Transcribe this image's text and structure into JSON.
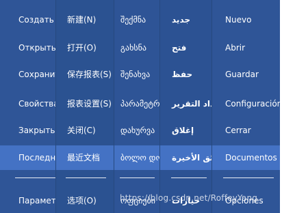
{
  "columns": [
    {
      "lang": "ru",
      "items": [
        "Создать",
        "Открыть",
        "Сохранить",
        "Свойства",
        "Закрыть",
        "Последние",
        "Параметры"
      ]
    },
    {
      "lang": "zh",
      "items": [
        "新建(N)",
        "打开(O)",
        "保存报表(S)",
        "报表设置(S)",
        "关闭(C)",
        "最近文档",
        "选项(O)"
      ]
    },
    {
      "lang": "ka",
      "items": [
        "შექმნა",
        "გახსნა",
        "შენახვა",
        "პარამეტრები",
        "დახურვა",
        "ბოლო დოკ",
        "ოფციები"
      ]
    },
    {
      "lang": "ar",
      "items": [
        "جديد",
        "فتح",
        "حفظ",
        "إعداد التقرير",
        "إغلاق",
        "وثائق الأخيرة",
        "خيارات"
      ]
    },
    {
      "lang": "es",
      "items": [
        "Nuevo",
        "Abrir",
        "Guardar",
        "Configuración",
        "Cerrar",
        "Documentos",
        "Opciones"
      ]
    }
  ],
  "selected_row": "Последние",
  "watermark": "https://blog.csdn.net/RoffeyYang",
  "colors": {
    "menu_background": "#2f5597",
    "selected_background": "#4472c4",
    "text": "#ffffff"
  }
}
